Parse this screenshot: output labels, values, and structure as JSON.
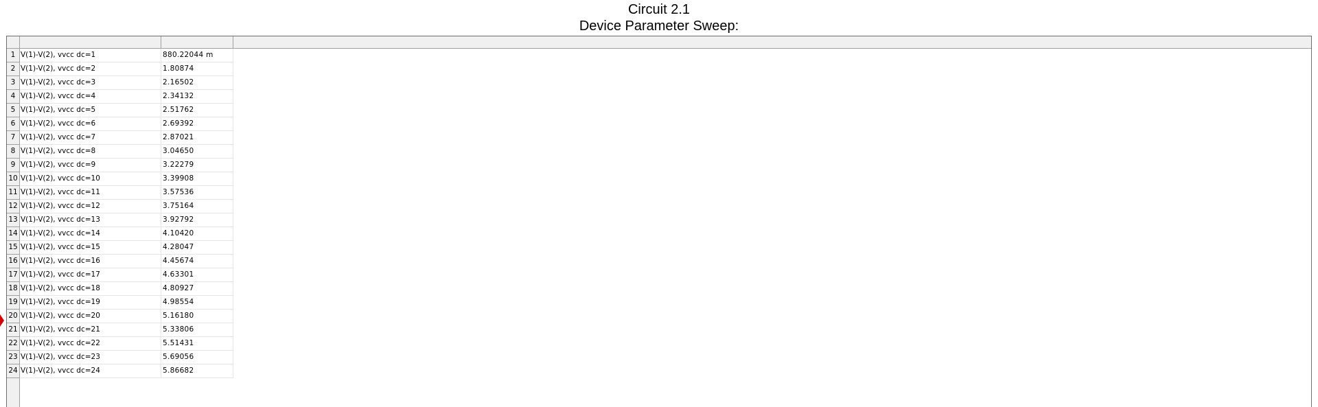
{
  "header": {
    "title": "Circuit 2.1",
    "subtitle": "Device Parameter Sweep:"
  },
  "table": {
    "columns": [
      "",
      ""
    ],
    "rows": [
      {
        "num": "1",
        "label": "V(1)-V(2), vvcc dc=1",
        "value": "880.22044 m"
      },
      {
        "num": "2",
        "label": "V(1)-V(2), vvcc dc=2",
        "value": "1.80874"
      },
      {
        "num": "3",
        "label": "V(1)-V(2), vvcc dc=3",
        "value": "2.16502"
      },
      {
        "num": "4",
        "label": "V(1)-V(2), vvcc dc=4",
        "value": "2.34132"
      },
      {
        "num": "5",
        "label": "V(1)-V(2), vvcc dc=5",
        "value": "2.51762"
      },
      {
        "num": "6",
        "label": "V(1)-V(2), vvcc dc=6",
        "value": "2.69392"
      },
      {
        "num": "7",
        "label": "V(1)-V(2), vvcc dc=7",
        "value": "2.87021"
      },
      {
        "num": "8",
        "label": "V(1)-V(2), vvcc dc=8",
        "value": "3.04650"
      },
      {
        "num": "9",
        "label": "V(1)-V(2), vvcc dc=9",
        "value": "3.22279"
      },
      {
        "num": "10",
        "label": "V(1)-V(2), vvcc dc=10",
        "value": "3.39908"
      },
      {
        "num": "11",
        "label": "V(1)-V(2), vvcc dc=11",
        "value": "3.57536"
      },
      {
        "num": "12",
        "label": "V(1)-V(2), vvcc dc=12",
        "value": "3.75164"
      },
      {
        "num": "13",
        "label": "V(1)-V(2), vvcc dc=13",
        "value": "3.92792"
      },
      {
        "num": "14",
        "label": "V(1)-V(2), vvcc dc=14",
        "value": "4.10420"
      },
      {
        "num": "15",
        "label": "V(1)-V(2), vvcc dc=15",
        "value": "4.28047"
      },
      {
        "num": "16",
        "label": "V(1)-V(2), vvcc dc=16",
        "value": "4.45674"
      },
      {
        "num": "17",
        "label": "V(1)-V(2), vvcc dc=17",
        "value": "4.63301"
      },
      {
        "num": "18",
        "label": "V(1)-V(2), vvcc dc=18",
        "value": "4.80927"
      },
      {
        "num": "19",
        "label": "V(1)-V(2), vvcc dc=19",
        "value": "4.98554"
      },
      {
        "num": "20",
        "label": "V(1)-V(2), vvcc dc=20",
        "value": "5.16180"
      },
      {
        "num": "21",
        "label": "V(1)-V(2), vvcc dc=21",
        "value": "5.33806"
      },
      {
        "num": "22",
        "label": "V(1)-V(2), vvcc dc=22",
        "value": "5.51431"
      },
      {
        "num": "23",
        "label": "V(1)-V(2), vvcc dc=23",
        "value": "5.69056"
      },
      {
        "num": "24",
        "label": "V(1)-V(2), vvcc dc=24",
        "value": "5.86682"
      }
    ]
  },
  "marker": {
    "icon": "current-row-arrow-icon",
    "color": "#d40000"
  }
}
